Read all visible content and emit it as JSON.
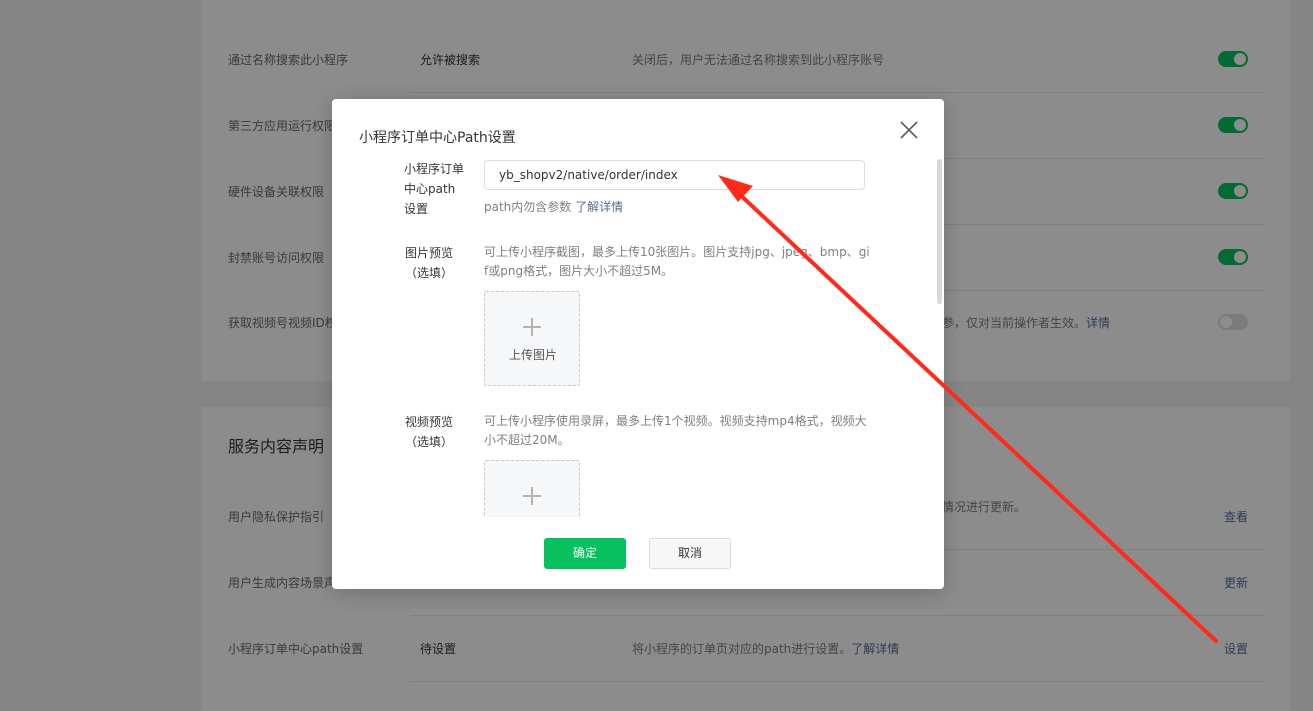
{
  "background": {
    "rows_top": [
      {
        "label": "通过名称搜索此小程序",
        "value": "允许被搜索",
        "desc": "关闭后，用户无法通过名称搜索到此小程序账号",
        "toggle": "on"
      },
      {
        "label": "第三方应用运行权限",
        "toggle": "on"
      },
      {
        "label": "硬件设备关联权限",
        "toggle": "on"
      },
      {
        "label": "封禁账号访问权限",
        "toggle": "on"
      },
      {
        "label": "获取视频号视频ID权",
        "desc": "参，仅对当前操作者生效。",
        "desc_link": "详情",
        "toggle": "off"
      }
    ],
    "section2_title": "服务内容声明",
    "rows_bottom": [
      {
        "label": "用户隐私保护指引",
        "desc": "情况进行更新。",
        "action": "查看"
      },
      {
        "label": "用户生成内容场景声",
        "action": "更新"
      },
      {
        "label": "小程序订单中心path设置",
        "value": "待设置",
        "desc": "将小程序的订单页对应的path进行设置。",
        "desc_link": "了解详情",
        "action": "设置"
      }
    ]
  },
  "dialog": {
    "title": "小程序订单中心Path设置",
    "path_label": "小程序订单中心path设置",
    "path_label_lines": [
      "小程序订单",
      "中心path",
      "设置"
    ],
    "path_value": "yb_shopv2/native/order/index",
    "path_hint": "path内勿含参数",
    "path_hint_link": "了解详情",
    "image_label_lines": [
      "图片预览",
      "（选填）"
    ],
    "image_hint_lines": [
      "可上传小程序截图，最多上传10张图片。图片支持jpg、jpeg、bmp、gi",
      "f或png格式，图片大小不超过5M。"
    ],
    "upload_image_label": "上传图片",
    "video_label_lines": [
      "视频预览",
      "（选填）"
    ],
    "video_hint_lines": [
      "可上传小程序使用录屏，最多上传1个视频。视频支持mp4格式，视频大",
      "小不超过20M。"
    ],
    "ok_label": "确定",
    "cancel_label": "取消"
  },
  "colors": {
    "primary_green": "#07c160",
    "link_blue": "#576b95",
    "annotation_red": "#ff2a1a"
  }
}
